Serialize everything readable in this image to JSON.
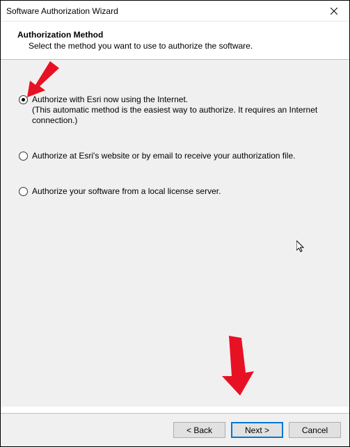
{
  "window": {
    "title": "Software Authorization Wizard"
  },
  "header": {
    "title": "Authorization Method",
    "subtitle": "Select the method you want to use to authorize the software."
  },
  "options": {
    "opt1_line1": "Authorize with Esri now using the Internet.",
    "opt1_line2": "(This automatic method is the easiest way to authorize. It requires an Internet connection.)",
    "opt2": "Authorize at Esri's website or by email to receive your authorization file.",
    "opt3": "Authorize your software from a local license server."
  },
  "buttons": {
    "back": "< Back",
    "next": "Next >",
    "cancel": "Cancel"
  }
}
